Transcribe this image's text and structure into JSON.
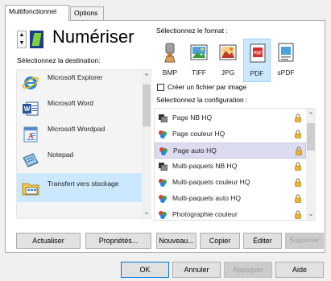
{
  "tabs": [
    {
      "label": "Multifonctionnel"
    },
    {
      "label": "Options"
    }
  ],
  "scan_title": "Numériser",
  "destination": {
    "label": "Sélectionnez la destination:",
    "items": [
      {
        "label": "Microsoft Explorer",
        "icon": "ie-icon"
      },
      {
        "label": "Microsoft Word",
        "icon": "word-icon"
      },
      {
        "label": "Microsoft Wordpad",
        "icon": "wordpad-icon"
      },
      {
        "label": "Notepad",
        "icon": "notepad-icon"
      },
      {
        "label": "Transfert vers stockage",
        "icon": "storage-icon",
        "selected": true
      }
    ]
  },
  "format": {
    "label": "Sélectionnez le format :",
    "items": [
      {
        "label": "BMP"
      },
      {
        "label": "TIFF"
      },
      {
        "label": "JPG"
      },
      {
        "label": "PDF",
        "selected": true
      },
      {
        "label": "sPDF"
      }
    ],
    "create_file_label": "Créer un fichier par image",
    "create_file_checked": false
  },
  "configuration": {
    "label": "Sélectionnez la configuration :",
    "items": [
      {
        "label": "Page NB HQ",
        "icon": "bw-scan-icon"
      },
      {
        "label": "Page couleur HQ",
        "icon": "color-scan-icon"
      },
      {
        "label": "Page auto HQ",
        "icon": "color-scan-icon",
        "selected": true
      },
      {
        "label": "Multi-paquets NB HQ",
        "icon": "bw-scan-icon"
      },
      {
        "label": "Multi-paquets couleur HQ",
        "icon": "color-scan-icon"
      },
      {
        "label": "Multi-paquets auto HQ",
        "icon": "color-scan-icon"
      },
      {
        "label": "Photographie couleur",
        "icon": "color-scan-icon"
      }
    ]
  },
  "buttons": {
    "refresh": "Actualiser",
    "properties": "Propriétés...",
    "new": "Nouveau...",
    "copy": "Copier",
    "edit": "Éditer",
    "delete": "Supprimer",
    "ok": "OK",
    "cancel": "Annuler",
    "apply": "Appliquer",
    "help": "Aide"
  },
  "colors": {
    "selection": "#cce8ff",
    "config_selection": "#dcdcf0",
    "lock": "#f0b428"
  }
}
